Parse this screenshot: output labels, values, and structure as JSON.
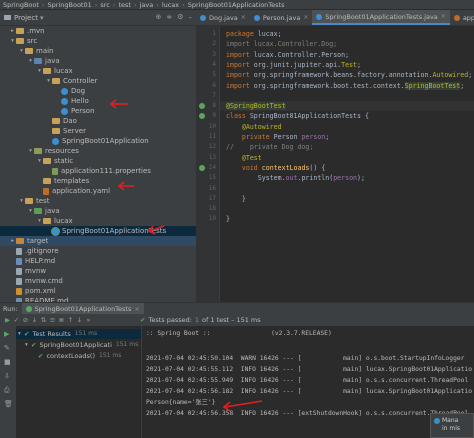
{
  "breadcrumb": [
    "SpringBoot",
    "SpringBoot01",
    "src",
    "test",
    "java",
    "lucax",
    "SpringBoot01ApplicationTests"
  ],
  "project_panel": {
    "title": "Project"
  },
  "tree": [
    {
      "label": ".mvn",
      "icon": "folder",
      "color": "y",
      "indent": 1,
      "arrow": "▸"
    },
    {
      "label": "src",
      "icon": "folder",
      "color": "y",
      "indent": 1,
      "arrow": "▾"
    },
    {
      "label": "main",
      "icon": "folder",
      "color": "y",
      "indent": 2,
      "arrow": "▾"
    },
    {
      "label": "java",
      "icon": "folder",
      "color": "b",
      "indent": 3,
      "arrow": "▾"
    },
    {
      "label": "lucax",
      "icon": "folder",
      "color": "y",
      "indent": 4,
      "arrow": "▾"
    },
    {
      "label": "Controller",
      "icon": "folder",
      "color": "y",
      "indent": 5,
      "arrow": "▾"
    },
    {
      "label": "Dog",
      "icon": "class",
      "indent": 6,
      "arrow": ""
    },
    {
      "label": "Hello",
      "icon": "class",
      "indent": 6,
      "arrow": ""
    },
    {
      "label": "Person",
      "icon": "class",
      "indent": 6,
      "arrow": ""
    },
    {
      "label": "Dao",
      "icon": "folder",
      "color": "y",
      "indent": 5,
      "arrow": ""
    },
    {
      "label": "Server",
      "icon": "folder",
      "color": "y",
      "indent": 5,
      "arrow": ""
    },
    {
      "label": "SpringBoot01Application",
      "icon": "class",
      "indent": 5,
      "arrow": ""
    },
    {
      "label": "resources",
      "icon": "folder",
      "color": "t",
      "indent": 3,
      "arrow": "▾"
    },
    {
      "label": "static",
      "icon": "folder",
      "color": "y",
      "indent": 4,
      "arrow": "▾"
    },
    {
      "label": "application111.properties",
      "icon": "prop",
      "indent": 5,
      "arrow": ""
    },
    {
      "label": "templates",
      "icon": "folder",
      "color": "y",
      "indent": 4,
      "arrow": ""
    },
    {
      "label": "application.yaml",
      "icon": "yml",
      "indent": 4,
      "arrow": ""
    },
    {
      "label": "test",
      "icon": "folder",
      "color": "y",
      "indent": 2,
      "arrow": "▾"
    },
    {
      "label": "java",
      "icon": "folder",
      "color": "g",
      "indent": 3,
      "arrow": "▾"
    },
    {
      "label": "lucax",
      "icon": "folder",
      "color": "y",
      "indent": 4,
      "arrow": "▾"
    },
    {
      "label": "SpringBoot01ApplicationTests",
      "icon": "testclass",
      "indent": 5,
      "arrow": "",
      "selected": true
    },
    {
      "label": "target",
      "icon": "folder",
      "color": "o",
      "indent": 1,
      "arrow": "▸",
      "selected2": true
    },
    {
      "label": ".gitignore",
      "icon": "file",
      "indent": 1,
      "arrow": ""
    },
    {
      "label": "HELP.md",
      "icon": "md",
      "indent": 1,
      "arrow": ""
    },
    {
      "label": "mvnw",
      "icon": "file",
      "indent": 1,
      "arrow": ""
    },
    {
      "label": "mvnw.cmd",
      "icon": "file",
      "indent": 1,
      "arrow": ""
    },
    {
      "label": "pom.xml",
      "icon": "xml",
      "indent": 1,
      "arrow": ""
    },
    {
      "label": "README.md",
      "icon": "md",
      "indent": 1,
      "arrow": ""
    }
  ],
  "tabs": [
    {
      "label": "Dog.java",
      "active": false
    },
    {
      "label": "Person.java",
      "active": false
    },
    {
      "label": "SpringBoot01ApplicationTests.java",
      "active": true
    },
    {
      "label": "application.yaml",
      "active": false
    }
  ],
  "code_lines": [
    {
      "n": "1",
      "html": "<span class=\"kw\">package</span> lucax;"
    },
    {
      "n": "2",
      "html": "<span class=\"gray\">import lucax.Controller.Dog;</span>"
    },
    {
      "n": "3",
      "html": "<span class=\"kw\">import</span> lucax.Controller.Person;"
    },
    {
      "n": "4",
      "html": "<span class=\"kw\">import</span> org.junit.jupiter.api.<span class=\"ann\">Test</span>;"
    },
    {
      "n": "5",
      "html": "<span class=\"kw\">import</span> org.springframework.beans.factory.annotation.<span class=\"ann\">Autowired</span>;"
    },
    {
      "n": "6",
      "html": "<span class=\"kw\">import</span> org.springframework.boot.test.context.<span class=\"ann hlbox\">SpringBootTest</span>;"
    },
    {
      "n": "7",
      "html": ""
    },
    {
      "n": "8",
      "html": "<span class=\"ann hlbox\">@SpringBootTest</span>",
      "gutter": "run"
    },
    {
      "n": "9",
      "html": "<span class=\"kw\">class</span> SpringBoot01ApplicationTests {",
      "gutter": "run"
    },
    {
      "n": "10",
      "html": "    <span class=\"ann\">@Autowired</span>"
    },
    {
      "n": "11",
      "html": "    <span class=\"kw\">private</span> Person <span class=\"fld\">person</span>;"
    },
    {
      "n": "12",
      "html": "<span class=\"cmt\">//    private Dog dog;</span>"
    },
    {
      "n": "13",
      "html": "    <span class=\"ann\">@Test</span>"
    },
    {
      "n": "14",
      "html": "    <span class=\"kw\">void</span> <span class=\"mth\">contextLoads</span>() {",
      "gutter": "run"
    },
    {
      "n": "15",
      "html": "        System.<span class=\"fld\">out</span>.println(<span class=\"fld\">person</span>);"
    },
    {
      "n": "16",
      "html": ""
    },
    {
      "n": "17",
      "html": "    }"
    },
    {
      "n": "18",
      "html": ""
    },
    {
      "n": "19",
      "html": "}"
    }
  ],
  "run": {
    "label": "Run:",
    "config": "SpringBoot01ApplicationTests",
    "status_text": "Tests passed:",
    "status_count": "1",
    "status_rest": "of 1 test – 151 ms"
  },
  "test_tree": [
    {
      "label": "Test Results",
      "ms": "151 ms",
      "indent": 0,
      "selected": true
    },
    {
      "label": "SpringBoot01Applicati",
      "ms": "151 ms",
      "indent": 1
    },
    {
      "label": "contextLoads()",
      "ms": "151 ms",
      "indent": 2
    }
  ],
  "console_lines": [
    {
      "text": ":: Spring Boot ::                (v2.3.7.RELEASE)",
      "cls": ""
    },
    {
      "text": "",
      "cls": ""
    },
    {
      "text": "2021-07-04 02:45:50.104  WARN 16426 --- [           main] o.s.boot.StartupInfoLogger",
      "cls": ""
    },
    {
      "text": "2021-07-04 02:45:55.112  INFO 16426 --- [           main] lucax.SpringBoot01Applicatio",
      "cls": ""
    },
    {
      "text": "2021-07-04 02:45:55.949  INFO 16426 --- [           main] o.s.s.concurrent.ThreadPool",
      "cls": ""
    },
    {
      "text": "2021-07-04 02:45:56.182  INFO 16426 --- [           main] lucax.SpringBoot01Applicatio",
      "cls": ""
    },
    {
      "text": "Person{name='张三'}",
      "cls": ""
    },
    {
      "text": "2021-07-04 02:45:56.358  INFO 16426 --- [extShutdownHook] o.s.s.concurrent.ThreadPool",
      "cls": ""
    }
  ],
  "notification": {
    "line1": "Mana",
    "line2": "in mis"
  }
}
